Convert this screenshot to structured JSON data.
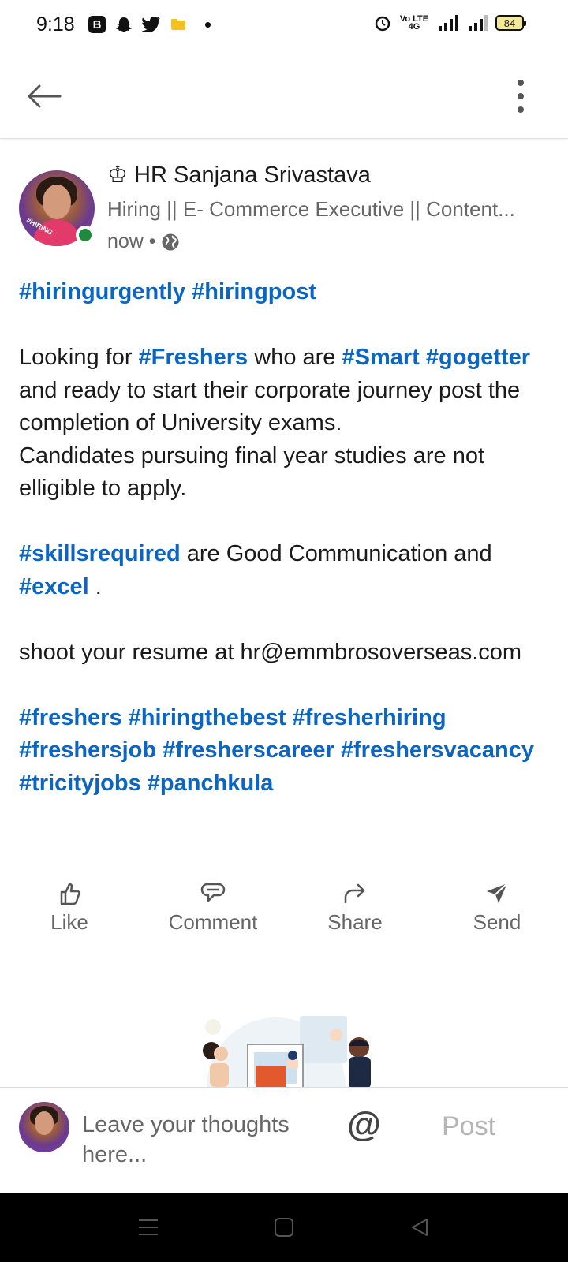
{
  "status_bar": {
    "time": "9:18",
    "app_b": "B",
    "network": "Vo LTE 4G",
    "battery": "84"
  },
  "post": {
    "author": "♔ HR Sanjana Srivastava",
    "headline": "Hiring || E- Commerce Executive || Content...",
    "time": "now •",
    "avatar_badge": "#HIRING",
    "body": [
      [
        {
          "t": "#hiringurgently",
          "tag": true
        },
        {
          "t": " "
        },
        {
          "t": "#hiringpost",
          "tag": true
        }
      ],
      [],
      [
        {
          "t": "Looking for "
        },
        {
          "t": "#Freshers",
          "tag": true
        },
        {
          "t": " who are "
        },
        {
          "t": "#Smart",
          "tag": true
        },
        {
          "t": " "
        },
        {
          "t": "#gogetter",
          "tag": true
        },
        {
          "t": " and ready to start their corporate journey post the completion of University exams."
        }
      ],
      [
        {
          "t": "Candidates pursuing final year studies are not elligible to apply."
        }
      ],
      [],
      [
        {
          "t": "#skillsrequired",
          "tag": true
        },
        {
          "t": " are Good Communication and "
        },
        {
          "t": "#excel",
          "tag": true
        },
        {
          "t": " ."
        }
      ],
      [],
      [
        {
          "t": "shoot your resume at hr@emmbrosoverseas.com"
        }
      ],
      [],
      [
        {
          "t": "#freshers",
          "tag": true
        },
        {
          "t": " "
        },
        {
          "t": "#hiringthebest",
          "tag": true
        },
        {
          "t": " "
        },
        {
          "t": "#fresherhiring",
          "tag": true
        },
        {
          "t": " "
        },
        {
          "t": "#freshersjob",
          "tag": true
        },
        {
          "t": " "
        },
        {
          "t": "#fresherscareer",
          "tag": true
        },
        {
          "t": " "
        },
        {
          "t": "#freshersvacancy",
          "tag": true
        },
        {
          "t": " "
        },
        {
          "t": "#tricityjobs",
          "tag": true
        },
        {
          "t": " "
        },
        {
          "t": "#panchkula",
          "tag": true
        }
      ]
    ]
  },
  "actions": {
    "like": "Like",
    "comment": "Comment",
    "share": "Share",
    "send": "Send"
  },
  "comment_bar": {
    "placeholder": "Leave your thoughts here...",
    "mention": "@",
    "post_label": "Post"
  },
  "colors": {
    "hashtag": "#0a66c2",
    "online": "#1e8a3e",
    "post_disabled": "#b5b5b5"
  },
  "icons": {
    "back": "arrow-left-icon",
    "more": "more-vertical-icon",
    "visibility": "globe-icon",
    "like": "thumbs-up-icon",
    "comment": "comment-icon",
    "share": "share-arrow-icon",
    "send": "send-icon"
  }
}
